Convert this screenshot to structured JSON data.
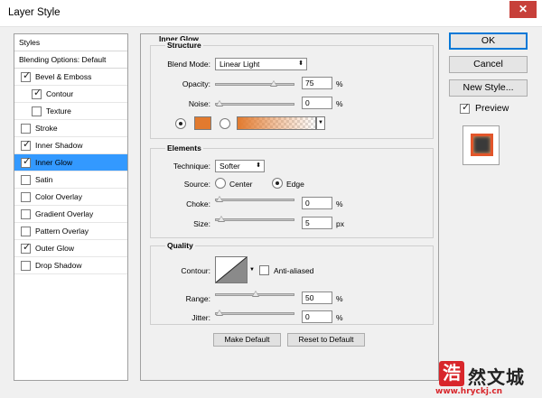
{
  "window": {
    "title": "Layer Style",
    "close_glyph": "✕"
  },
  "sidebar": {
    "items": [
      {
        "label": "Styles",
        "checkbox": "none",
        "checked": false,
        "selected": false
      },
      {
        "label": "Blending Options: Default",
        "checkbox": "none",
        "checked": false,
        "selected": false
      },
      {
        "label": "Bevel & Emboss",
        "checkbox": "yes",
        "checked": true,
        "selected": false
      },
      {
        "label": "Contour",
        "checkbox": "yes",
        "checked": true,
        "selected": false,
        "indent": true
      },
      {
        "label": "Texture",
        "checkbox": "yes",
        "checked": false,
        "selected": false,
        "indent": true
      },
      {
        "label": "Stroke",
        "checkbox": "yes",
        "checked": false,
        "selected": false
      },
      {
        "label": "Inner Shadow",
        "checkbox": "yes",
        "checked": true,
        "selected": false
      },
      {
        "label": "Inner Glow",
        "checkbox": "yes",
        "checked": true,
        "selected": true
      },
      {
        "label": "Satin",
        "checkbox": "yes",
        "checked": false,
        "selected": false
      },
      {
        "label": "Color Overlay",
        "checkbox": "yes",
        "checked": false,
        "selected": false
      },
      {
        "label": "Gradient Overlay",
        "checkbox": "yes",
        "checked": false,
        "selected": false
      },
      {
        "label": "Pattern Overlay",
        "checkbox": "yes",
        "checked": false,
        "selected": false
      },
      {
        "label": "Outer Glow",
        "checkbox": "yes",
        "checked": true,
        "selected": false
      },
      {
        "label": "Drop Shadow",
        "checkbox": "yes",
        "checked": false,
        "selected": false
      }
    ]
  },
  "panel": {
    "title": "Inner Glow",
    "structure": {
      "title": "Structure",
      "blend_mode_label": "Blend Mode:",
      "blend_mode_value": "Linear Light",
      "opacity_label": "Opacity:",
      "opacity_value": "75",
      "opacity_unit": "%",
      "opacity_level": 0.75,
      "noise_label": "Noise:",
      "noise_value": "0",
      "noise_unit": "%",
      "noise_level": 0,
      "glow_color": "#e27a2e"
    },
    "elements": {
      "title": "Elements",
      "technique_label": "Technique:",
      "technique_value": "Softer",
      "source_label": "Source:",
      "source_center": "Center",
      "source_edge": "Edge",
      "choke_label": "Choke:",
      "choke_value": "0",
      "choke_unit": "%",
      "choke_level": 0,
      "size_label": "Size:",
      "size_value": "5",
      "size_unit": "px",
      "size_level": 0.02
    },
    "quality": {
      "title": "Quality",
      "contour_label": "Contour:",
      "anti_aliased_label": "Anti-aliased",
      "range_label": "Range:",
      "range_value": "50",
      "range_unit": "%",
      "range_level": 0.5,
      "jitter_label": "Jitter:",
      "jitter_value": "0",
      "jitter_unit": "%",
      "jitter_level": 0
    },
    "make_default": "Make Default",
    "reset_default": "Reset to Default"
  },
  "actions": {
    "ok": "OK",
    "cancel": "Cancel",
    "new_style": "New Style...",
    "preview_label": "Preview",
    "preview_checked": true
  },
  "watermark": {
    "badge": "浩",
    "text": "然文城",
    "url": "www.hryckj.cn"
  },
  "colors": {
    "selection": "#3399ff",
    "glow": "#e27a2e",
    "preview_edge": "#e2552a"
  }
}
